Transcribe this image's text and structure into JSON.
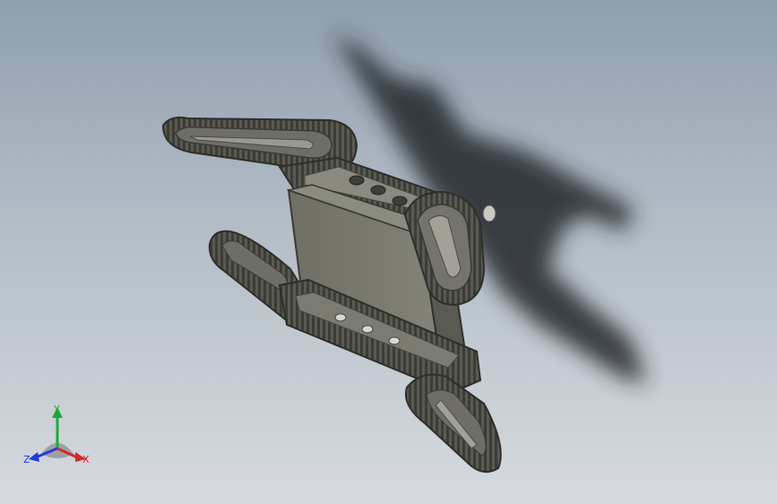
{
  "triad": {
    "y_label": "Y",
    "z_label": "Z",
    "x_label": "X",
    "colors": {
      "y": "#1fa83a",
      "z": "#1f3bd6",
      "x": "#d42a2a"
    }
  },
  "model": {
    "body_color": "#74746a",
    "track_color": "#55554f",
    "shadow_color": "#1e2226"
  }
}
